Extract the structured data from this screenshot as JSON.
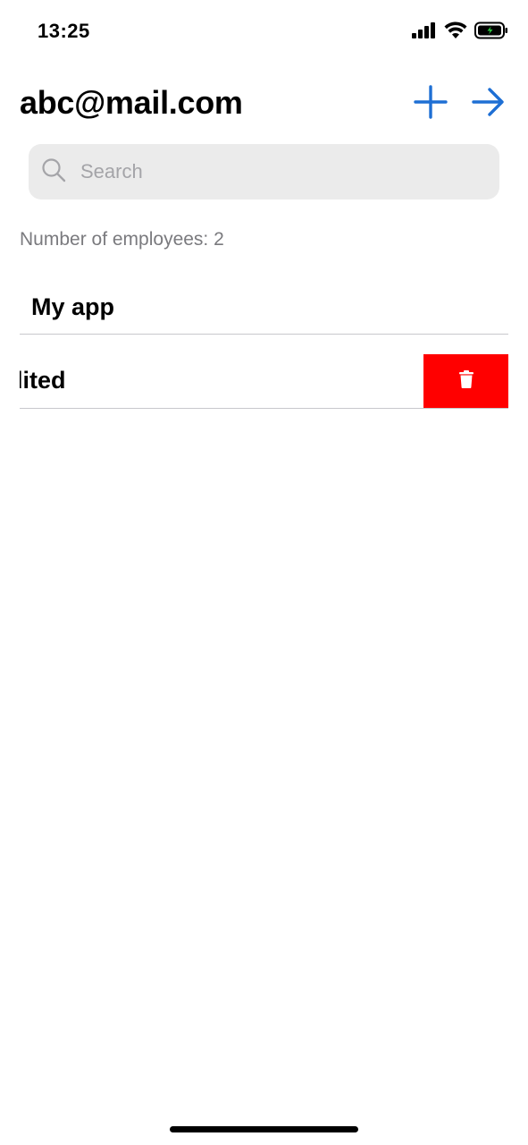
{
  "status_bar": {
    "time": "13:25",
    "icons": [
      "cellular-signal-icon",
      "wifi-icon",
      "battery-charging-icon"
    ]
  },
  "nav": {
    "title": "abc@mail.com",
    "add_icon": "plus-icon",
    "next_icon": "arrow-right-icon"
  },
  "search": {
    "placeholder": "Search",
    "value": "",
    "icon": "search-icon"
  },
  "employee_count_text": "Number of employees: 2",
  "list": {
    "items": [
      {
        "label": "My app",
        "swiped": false
      },
      {
        "label": "dited",
        "swiped": true,
        "action_icon": "trash-icon"
      }
    ]
  },
  "colors": {
    "accent": "#1e6fd4",
    "delete": "#ff0000",
    "search_bg": "#ebebeb",
    "secondary_text": "#7a7a7e"
  }
}
